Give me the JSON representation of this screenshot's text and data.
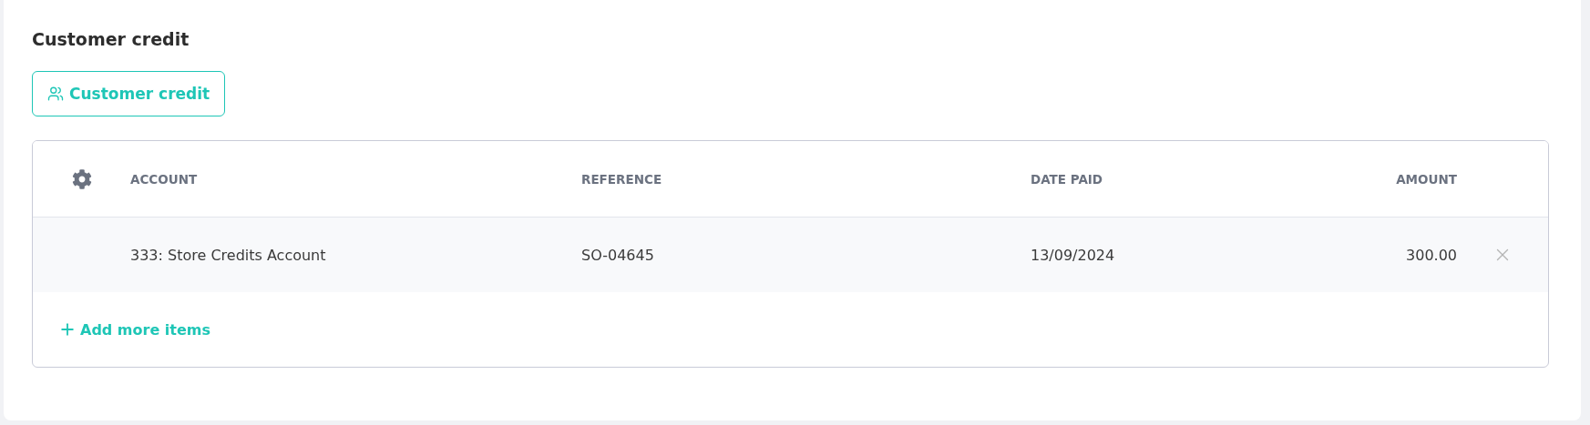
{
  "section": {
    "title": "Customer credit"
  },
  "action_button": {
    "label": "Customer credit"
  },
  "table": {
    "columns": [
      "ACCOUNT",
      "REFERENCE",
      "DATE PAID",
      "AMOUNT"
    ],
    "rows": [
      {
        "account": "333: Store Credits Account",
        "reference": "SO-04645",
        "date_paid": "13/09/2024",
        "amount": "300.00"
      }
    ],
    "add_link": "Add more items"
  }
}
